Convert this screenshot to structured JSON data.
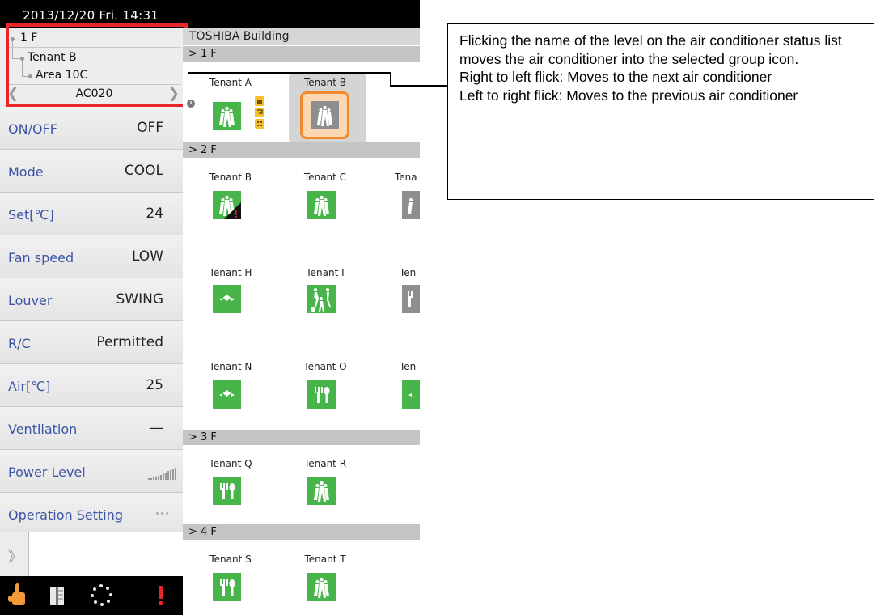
{
  "status_bar": {
    "datetime": "2013/12/20  Fri.  14:31"
  },
  "tree": {
    "floor": "1 F",
    "tenant": "Tenant B",
    "area": "Area 10C",
    "unit": "AC020",
    "prev_icon": "chevron-left-icon",
    "next_icon": "chevron-right-icon"
  },
  "settings": [
    {
      "label": "ON/OFF",
      "value": "OFF"
    },
    {
      "label": "Mode",
      "value": "COOL"
    },
    {
      "label": "Set[℃]",
      "value": "24"
    },
    {
      "label": "Fan speed",
      "value": "LOW"
    },
    {
      "label": "Louver",
      "value": "SWING"
    },
    {
      "label": "R/C",
      "value": "Permitted"
    },
    {
      "label": "Air[℃]",
      "value": "25"
    },
    {
      "label": "Ventilation",
      "value": "—"
    },
    {
      "label": "Power Level",
      "value": ""
    },
    {
      "label": "Operation Setting",
      "value": ""
    }
  ],
  "expander": {
    "icon": "double-chevron-right-icon"
  },
  "bottom_bar": {
    "buttons": [
      "hand-pointer-icon",
      "book-icon",
      "dotted-circle-icon",
      "alert-icon"
    ],
    "alert_color": "#e8262c"
  },
  "building": {
    "name": "TOSHIBA Building"
  },
  "floors": [
    {
      "label": "> 1 F",
      "tenants": [
        "Tenant A",
        "Tenant B"
      ]
    },
    {
      "label": "> 2 F",
      "tenants": [
        "Tenant B",
        "Tenant C",
        "Tena",
        "Tenant H",
        "Tenant I",
        "Ten",
        "Tenant N",
        "Tenant O",
        "Ten"
      ]
    },
    {
      "label": "> 3 F",
      "tenants": [
        "Tenant Q",
        "Tenant R"
      ]
    },
    {
      "label": "> 4 F",
      "tenants": [
        "Tenant S",
        "Tenant T"
      ]
    }
  ],
  "colors": {
    "tenant_green": "#47b54a",
    "tenant_gray": "#8e8e8e",
    "highlight_red": "#e8262c",
    "selected_orange": "#f08a2c",
    "label_blue": "#3c55a5"
  },
  "callout": {
    "text": "Flicking the name of the level on the air conditioner status list moves the air conditioner into the selected group icon.\nRight to left flick: Moves to the next air conditioner\nLeft to right flick: Moves to the previous air conditioner"
  }
}
